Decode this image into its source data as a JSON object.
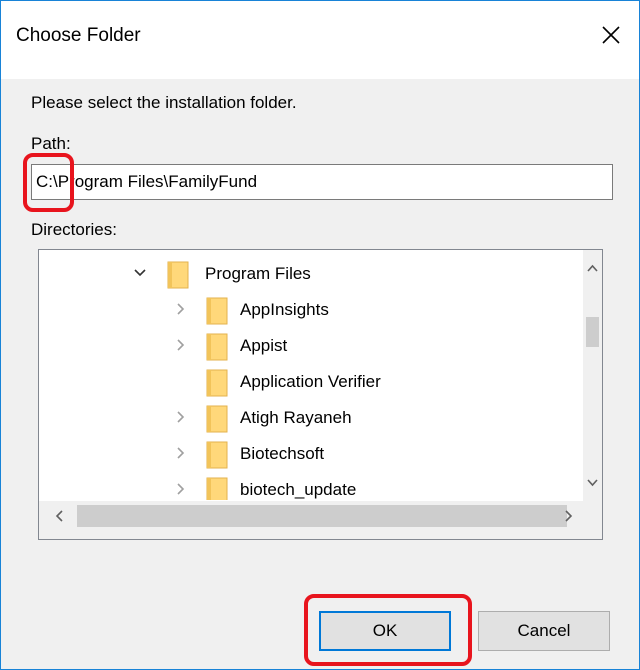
{
  "dialog": {
    "title": "Choose Folder",
    "instruction": "Please select the installation folder.",
    "path_label": "Path:",
    "path_value": "C:\\Program Files\\FamilyFund",
    "directories_label": "Directories:"
  },
  "tree": {
    "items": [
      {
        "label": "Program Files",
        "level": 0,
        "expander": "expanded"
      },
      {
        "label": "AppInsights",
        "level": 1,
        "expander": "collapsed"
      },
      {
        "label": "Appist",
        "level": 1,
        "expander": "collapsed"
      },
      {
        "label": "Application Verifier",
        "level": 1,
        "expander": "none"
      },
      {
        "label": "Atigh Rayaneh",
        "level": 1,
        "expander": "collapsed"
      },
      {
        "label": "Biotechsoft",
        "level": 1,
        "expander": "collapsed"
      },
      {
        "label": "biotech_update",
        "level": 1,
        "expander": "collapsed"
      }
    ]
  },
  "buttons": {
    "ok": "OK",
    "cancel": "Cancel"
  },
  "icons": {
    "close": "close-icon",
    "folder": "folder-icon",
    "chevron_down": "chevron-down-icon",
    "chevron_right": "chevron-right-icon"
  },
  "colors": {
    "window_border": "#1883d7",
    "highlight": "#e8141d",
    "folder": "#ffd87a",
    "default_button_border": "#0078d7"
  }
}
